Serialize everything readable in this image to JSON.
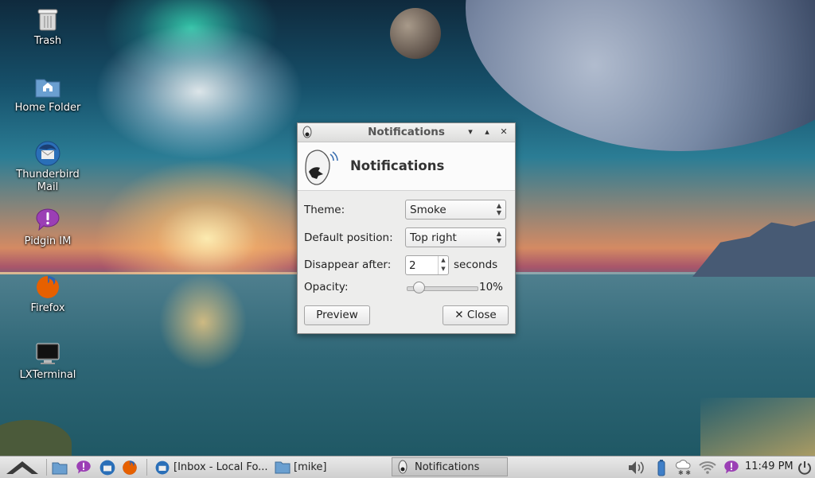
{
  "desktop": {
    "icons": [
      {
        "label": "Trash"
      },
      {
        "label": "Home Folder"
      },
      {
        "label": "Thunderbird Mail"
      },
      {
        "label": "Pidgin IM"
      },
      {
        "label": "Firefox"
      },
      {
        "label": "LXTerminal"
      }
    ]
  },
  "dialog": {
    "title": "Notifications",
    "header": "Notifications",
    "theme_label": "Theme:",
    "theme_value": "Smoke",
    "position_label": "Default position:",
    "position_value": "Top right",
    "disappear_label": "Disappear after:",
    "disappear_value": "2",
    "disappear_unit": "seconds",
    "opacity_label": "Opacity:",
    "opacity_value": "10%",
    "opacity_fraction": 0.1,
    "preview_label": "Preview",
    "close_label": "Close"
  },
  "taskbar": {
    "windows": [
      {
        "label": "[Inbox - Local Fo..."
      },
      {
        "label": "[mike]"
      },
      {
        "label": "Notifications"
      }
    ],
    "clock": "11:49 PM"
  },
  "colors": {
    "accent_purple": "#9b3fb5",
    "firefox_orange": "#e66000",
    "thunderbird_blue": "#2a6fb8"
  }
}
